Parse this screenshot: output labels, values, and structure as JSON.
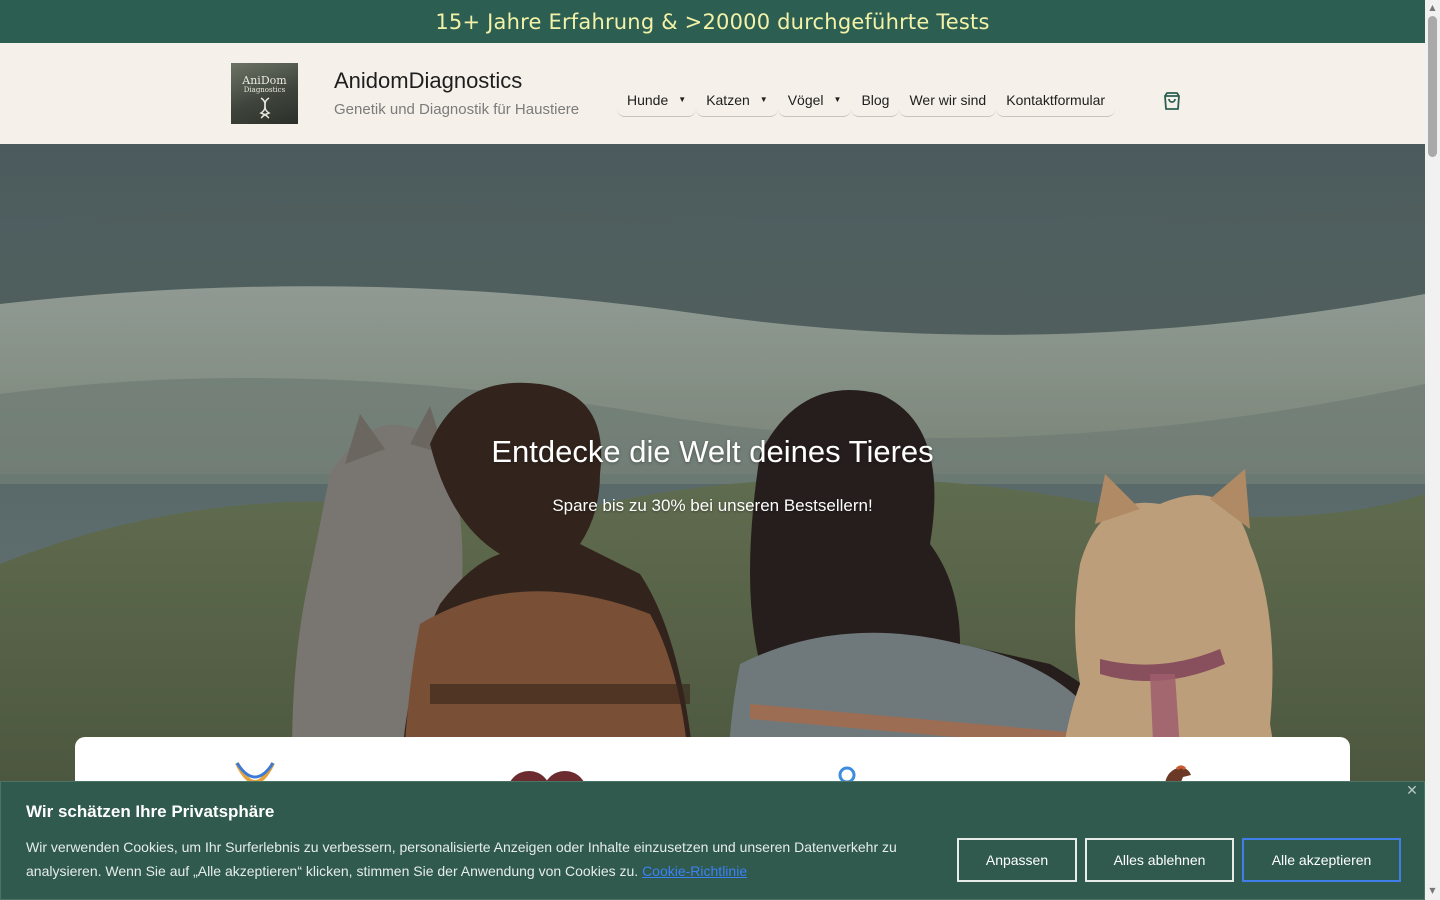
{
  "banner": {
    "text": "15+ Jahre Erfahrung & >20000 durchgeführte Tests"
  },
  "header": {
    "logo": {
      "line1": "AniDom",
      "line2": "Diagnostics"
    },
    "site_title": "AnidomDiagnostics",
    "tagline": "Genetik und Diagnostik für Haustiere",
    "nav": [
      {
        "label": "Hunde",
        "has_dropdown": true
      },
      {
        "label": "Katzen",
        "has_dropdown": true
      },
      {
        "label": "Vögel",
        "has_dropdown": true
      },
      {
        "label": "Blog",
        "has_dropdown": false
      },
      {
        "label": "Wer wir sind",
        "has_dropdown": false
      },
      {
        "label": "Kontaktformular",
        "has_dropdown": false
      }
    ],
    "cart_icon": "shopping-bag-icon"
  },
  "hero": {
    "title": "Entdecke die Welt deines Tieres",
    "subtitle": "Spare bis zu 30% bei unseren Bestsellern!"
  },
  "cookie": {
    "title": "Wir schätzen Ihre Privatsphäre",
    "text": "Wir verwenden Cookies, um Ihr Surferlebnis zu verbessern, personalisierte Anzeigen oder Inhalte einzusetzen und unseren Datenverkehr zu analysieren. Wenn Sie auf „Alle akzeptieren“ klicken, stimmen Sie der Anwendung von Cookies zu.",
    "link": "Cookie-Richtlinie",
    "buttons": {
      "customize": "Anpassen",
      "reject": "Alles ablehnen",
      "accept": "Alle akzeptieren"
    }
  },
  "colors": {
    "banner_bg": "#2c5f52",
    "banner_text": "#f3f2a8",
    "header_bg": "#f5f1ea",
    "cookie_bg": "#2f5a4d",
    "accept_border": "#3f7ee8",
    "link": "#3b82f6"
  }
}
